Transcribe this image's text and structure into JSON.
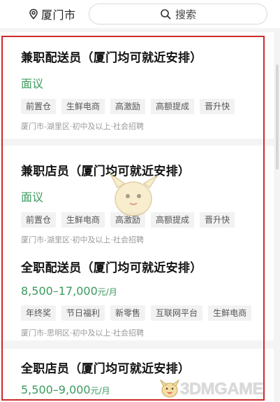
{
  "header": {
    "city": "厦门市",
    "search_placeholder": "搜索"
  },
  "jobs": [
    {
      "title": "兼职配送员（厦门均可就近安排）",
      "salary": "面议",
      "salary_unit": "",
      "tags": [
        "前置仓",
        "生鲜电商",
        "高激励",
        "高额提成",
        "晋升快"
      ],
      "meta": "厦门市-湖里区·初中及以上·社会招聘"
    },
    {
      "title": "兼职店员（厦门均可就近安排）",
      "salary": "面议",
      "salary_unit": "",
      "tags": [
        "前置仓",
        "生鲜电商",
        "高激励",
        "高额提成",
        "晋升快"
      ],
      "meta": "厦门市-湖里区·初中及以上·社会招聘"
    },
    {
      "title": "全职配送员（厦门均可就近安排）",
      "salary": "8,500–17,000",
      "salary_unit": "元/月",
      "tags": [
        "年终奖",
        "节日福利",
        "新零售",
        "互联网平台",
        "生鲜电商"
      ],
      "meta": "厦门市-思明区·初中及以上·社会招聘"
    },
    {
      "title": "全职店员（厦门均可就近安排）",
      "salary": "5,500–9,000",
      "salary_unit": "元/月",
      "tags": [],
      "meta": ""
    }
  ],
  "watermark": "3DMGAME",
  "colors": {
    "salary_green": "#3c9a5f",
    "highlight_red": "#cc2b2b"
  }
}
